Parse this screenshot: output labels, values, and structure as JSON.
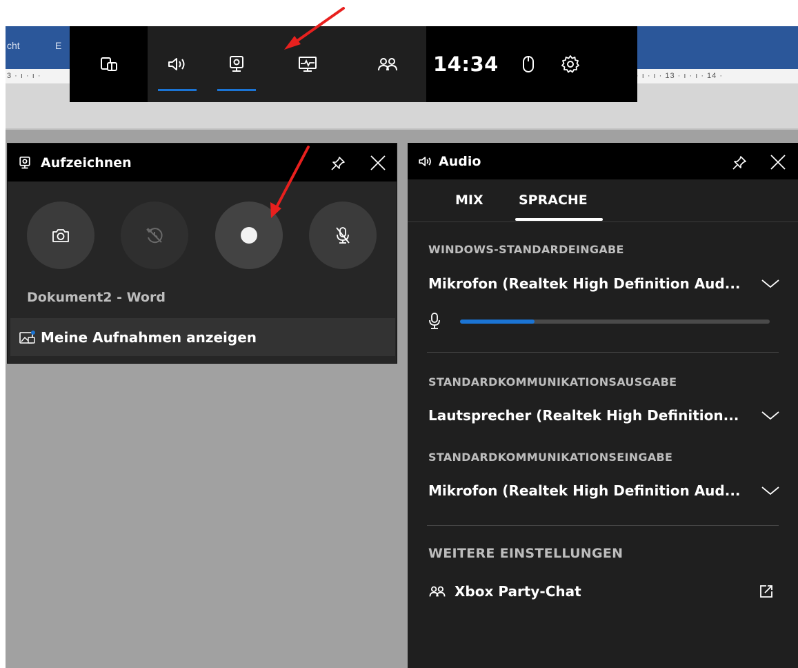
{
  "word": {
    "ribbon_tab_1": "cht",
    "ribbon_tab_2": "E",
    "ruler_left": "3 · ı · ı ·",
    "ruler_right": "· ı · ı · 13 · ı · ı · 14 ·"
  },
  "gamebar": {
    "time": "14:34",
    "accent": "#1b74d4",
    "icons": [
      "widget-menu-icon",
      "audio-icon",
      "capture-icon",
      "performance-icon",
      "social-icon",
      "mouse-icon",
      "settings-icon"
    ]
  },
  "capture_panel": {
    "title": "Aufzeichnen",
    "app_name": "Dokument2 - Word",
    "show_recordings": "Meine Aufnahmen anzeigen"
  },
  "audio_panel": {
    "title": "Audio",
    "tabs": [
      {
        "label": "MIX",
        "selected": false
      },
      {
        "label": "SPRACHE",
        "selected": true
      }
    ],
    "windows_input": {
      "label": "WINDOWS-STANDARDEINGABE",
      "device": "Mikrofon (Realtek High Definition Aud... "
    },
    "mic_level": 0.24,
    "comm_output": {
      "label": "STANDARDKOMMUNIKATIONSAUSGABE",
      "device": "Lautsprecher (Realtek High Definition... "
    },
    "comm_input": {
      "label": "STANDARDKOMMUNIKATIONSEINGABE",
      "device": "Mikrofon (Realtek High Definition Aud... "
    },
    "more_settings": {
      "label": "WEITERE EINSTELLUNGEN",
      "party_chat": "Xbox Party-Chat"
    }
  },
  "annotation_color": "#e8201e"
}
